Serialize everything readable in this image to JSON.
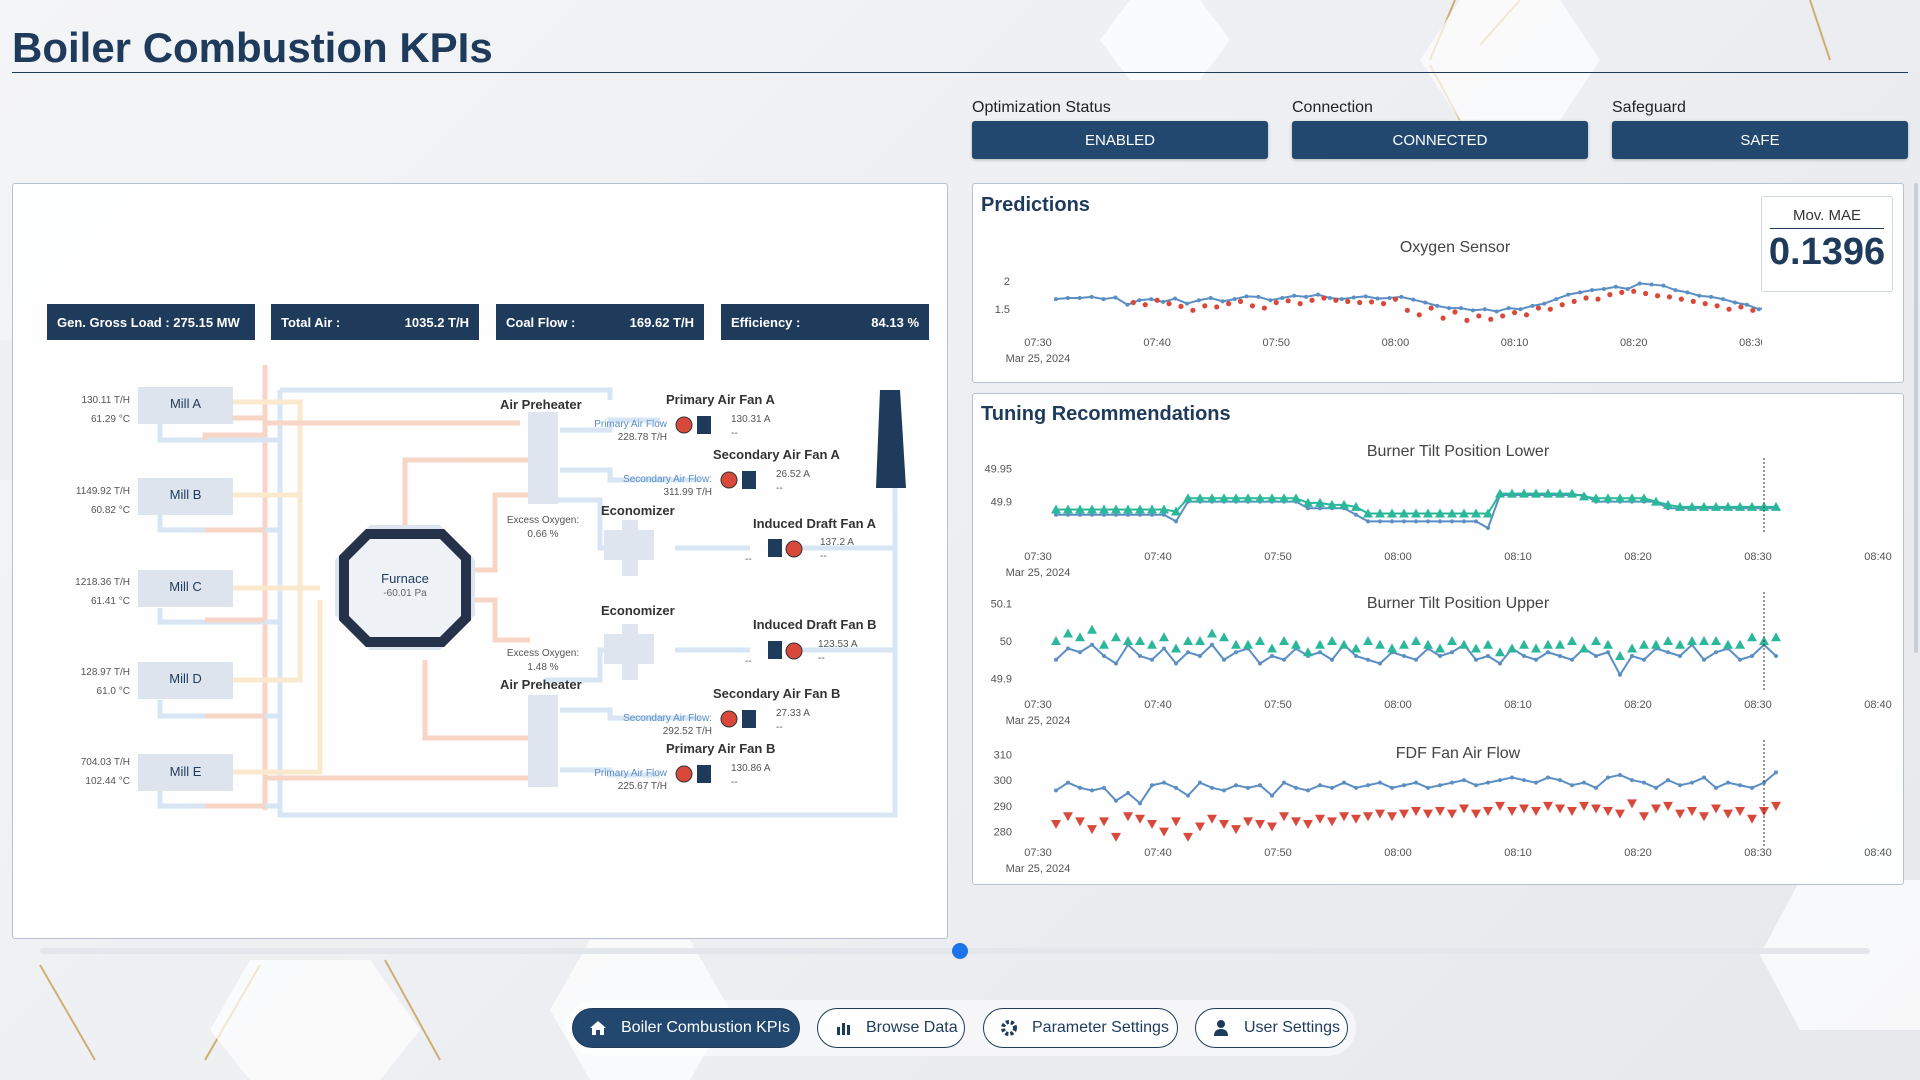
{
  "page": {
    "title": "Boiler Combustion KPIs"
  },
  "status": [
    {
      "label": "Optimization Status",
      "value": "ENABLED"
    },
    {
      "label": "Connection",
      "value": "CONNECTED"
    },
    {
      "label": "Safeguard",
      "value": "SAFE"
    }
  ],
  "kpis": [
    {
      "label": "Gen. Gross Load : 275.15 MW",
      "value": ""
    },
    {
      "label": "Total Air :",
      "value": "1035.2 T/H"
    },
    {
      "label": "Coal Flow :",
      "value": "169.62 T/H"
    },
    {
      "label": "Efficiency :",
      "value": "84.13 %"
    }
  ],
  "mills": [
    {
      "name": "Mill A",
      "flow": "130.11 T/H",
      "temp": "61.29 °C"
    },
    {
      "name": "Mill B",
      "flow": "1149.92 T/H",
      "temp": "60.82 °C"
    },
    {
      "name": "Mill C",
      "flow": "1218.36 T/H",
      "temp": "61.41 °C"
    },
    {
      "name": "Mill D",
      "flow": "128.97 T/H",
      "temp": "61.0 °C"
    },
    {
      "name": "Mill E",
      "flow": "704.03 T/H",
      "temp": "102.44 °C"
    }
  ],
  "furnace": {
    "name": "Furnace",
    "pressure": "-60.01 Pa"
  },
  "diagram": {
    "air_preheater_top": "Air Preheater",
    "air_preheater_bottom": "Air Preheater",
    "economizer_top": "Economizer",
    "economizer_bottom": "Economizer",
    "excess_o2_label": "Excess Oxygen:",
    "excess_o2_top": "0.66 %",
    "excess_o2_bottom": "1.48 %",
    "fans": [
      {
        "name": "Primary Air Fan A",
        "flow_label": "Primary Air Flow",
        "flow": "228.78 T/H",
        "current": "130.31 A",
        "extra": "--"
      },
      {
        "name": "Secondary Air Fan A",
        "flow_label": "Secondary Air Flow:",
        "flow": "311.99 T/H",
        "current": "26.52 A",
        "extra": "--"
      },
      {
        "name": "Induced Draft Fan A",
        "flow_label": "",
        "flow": "--",
        "current": "137.2 A",
        "extra": "--"
      },
      {
        "name": "Induced Draft Fan B",
        "flow_label": "",
        "flow": "--",
        "current": "123.53 A",
        "extra": "--"
      },
      {
        "name": "Secondary Air Fan B",
        "flow_label": "Secondary Air Flow:",
        "flow": "292.52 T/H",
        "current": "27.33 A",
        "extra": "--"
      },
      {
        "name": "Primary Air Fan B",
        "flow_label": "Primary Air Flow",
        "flow": "225.67 T/H",
        "current": "130.86 A",
        "extra": "--"
      }
    ]
  },
  "predictions": {
    "title": "Predictions",
    "mae_label": "Mov. MAE",
    "mae_value": "0.1396",
    "chart_title": "Oxygen Sensor"
  },
  "tuning": {
    "title": "Tuning Recommendations"
  },
  "time_axis": {
    "ticks": [
      "07:30",
      "07:40",
      "07:50",
      "08:00",
      "08:10",
      "08:20",
      "08:30",
      "08:40"
    ],
    "date": "Mar 25, 2024"
  },
  "chart_data": [
    {
      "type": "line",
      "title": "Oxygen Sensor",
      "x_range": [
        "07:30",
        "08:40"
      ],
      "ylim": [
        1.2,
        2.2
      ],
      "yticks": [
        "2",
        "1.5"
      ],
      "series": [
        {
          "name": "",
          "color": "#5b8fc4",
          "x_start_min": 1.5,
          "step_min": 1,
          "values": [
            1.68,
            1.7,
            1.7,
            1.72,
            1.68,
            1.71,
            1.58,
            1.66,
            1.68,
            1.63,
            1.69,
            1.6,
            1.66,
            1.7,
            1.64,
            1.68,
            1.73,
            1.72,
            1.66,
            1.7,
            1.74,
            1.72,
            1.76,
            1.7,
            1.68,
            1.71,
            1.73,
            1.69,
            1.7,
            1.72,
            1.67,
            1.62,
            1.56,
            1.52,
            1.52,
            1.48,
            1.5,
            1.46,
            1.52,
            1.5,
            1.56,
            1.6,
            1.68,
            1.76,
            1.8,
            1.84,
            1.86,
            1.9,
            1.86,
            1.96,
            1.94,
            1.92,
            1.84,
            1.8,
            1.74,
            1.72,
            1.68,
            1.62,
            1.58,
            1.5,
            1.55,
            1.52,
            1.44,
            1.5,
            1.46,
            1.4
          ]
        },
        {
          "name": "",
          "color": "#d9493b",
          "x_start_min": 8,
          "step_min": 1,
          "values": [
            1.62,
            1.58,
            1.66,
            1.6,
            1.55,
            1.48,
            1.56,
            1.54,
            1.6,
            1.64,
            1.56,
            1.52,
            1.62,
            1.65,
            1.6,
            1.66,
            1.7,
            1.66,
            1.64,
            1.62,
            1.63,
            1.6,
            1.68,
            1.48,
            1.4,
            1.52,
            1.34,
            1.45,
            1.3,
            1.38,
            1.32,
            1.38,
            1.44,
            1.4,
            1.52,
            1.5,
            1.58,
            1.64,
            1.7,
            1.68,
            1.76,
            1.8,
            1.82,
            1.78,
            1.74,
            1.72,
            1.68,
            1.64,
            1.6,
            1.56,
            1.5,
            1.54,
            1.48,
            1.5,
            1.44,
            1.48,
            1.4,
            1.38,
            1.36,
            1.38,
            1.36,
            1.34,
            1.3,
            1.32
          ]
        }
      ]
    },
    {
      "type": "line",
      "title": "Burner Tilt Position Lower",
      "x_range": [
        "07:30",
        "08:40"
      ],
      "ylim": [
        49.86,
        49.96
      ],
      "yticks": [
        "49.95",
        "49.9"
      ],
      "series": [
        {
          "name": "",
          "color": "#5b8fc4",
          "marker": "line",
          "x_start_min": 1.5,
          "step_min": 1,
          "values": [
            49.88,
            49.88,
            49.88,
            49.88,
            49.88,
            49.88,
            49.88,
            49.88,
            49.88,
            49.88,
            49.87,
            49.9,
            49.9,
            49.9,
            49.9,
            49.9,
            49.9,
            49.9,
            49.9,
            49.9,
            49.9,
            49.89,
            49.89,
            49.89,
            49.89,
            49.88,
            49.87,
            49.87,
            49.87,
            49.87,
            49.87,
            49.87,
            49.87,
            49.87,
            49.87,
            49.87,
            49.86,
            49.91,
            49.91,
            49.91,
            49.91,
            49.91,
            49.91,
            49.91,
            49.91,
            49.9,
            49.9,
            49.9,
            49.9,
            49.9,
            49.9,
            49.89,
            49.89,
            49.89,
            49.89,
            49.89,
            49.89,
            49.89,
            49.89,
            49.89,
            49.89
          ]
        },
        {
          "name": "",
          "color": "#2bb89a",
          "marker": "triangle-up",
          "x_start_min": 1.5,
          "step_min": 1,
          "values": [
            49.888,
            49.888,
            49.888,
            49.888,
            49.888,
            49.888,
            49.888,
            49.888,
            49.888,
            49.888,
            49.885,
            49.905,
            49.905,
            49.905,
            49.905,
            49.905,
            49.905,
            49.905,
            49.905,
            49.905,
            49.905,
            49.898,
            49.898,
            49.895,
            49.895,
            49.892,
            49.882,
            49.882,
            49.882,
            49.882,
            49.882,
            49.882,
            49.882,
            49.882,
            49.882,
            49.882,
            49.882,
            49.912,
            49.912,
            49.912,
            49.912,
            49.912,
            49.912,
            49.912,
            49.908,
            49.905,
            49.905,
            49.905,
            49.905,
            49.905,
            49.9,
            49.895,
            49.892,
            49.892,
            49.892,
            49.892,
            49.892,
            49.892,
            49.892,
            49.892,
            49.892
          ]
        }
      ]
    },
    {
      "type": "scatter",
      "title": "Burner Tilt Position Upper",
      "x_range": [
        "07:30",
        "08:40"
      ],
      "ylim": [
        49.88,
        50.12
      ],
      "yticks": [
        "50.1",
        "50",
        "49.9"
      ],
      "series": [
        {
          "name": "",
          "color": "#5b8fc4",
          "marker": "line",
          "x_start_min": 1.5,
          "step_min": 1,
          "values": [
            49.95,
            49.98,
            49.97,
            49.99,
            49.96,
            49.94,
            49.99,
            49.96,
            49.95,
            49.98,
            49.94,
            49.97,
            49.96,
            49.99,
            49.95,
            49.97,
            49.98,
            49.94,
            49.96,
            49.95,
            49.98,
            49.96,
            49.97,
            49.95,
            49.99,
            49.96,
            49.95,
            49.94,
            49.97,
            49.96,
            49.95,
            49.98,
            49.96,
            49.97,
            49.99,
            49.95,
            49.96,
            49.94,
            49.98,
            49.96,
            49.95,
            49.97,
            49.96,
            49.95,
            49.98,
            49.96,
            49.97,
            49.91,
            49.96,
            49.95,
            49.98,
            49.97,
            49.96,
            49.99,
            49.95,
            49.97,
            49.98,
            49.95,
            49.96,
            49.99,
            49.96
          ]
        },
        {
          "name": "",
          "color": "#2bb89a",
          "marker": "triangle-up",
          "x_start_min": 1.5,
          "step_min": 1,
          "values": [
            50.0,
            50.02,
            50.01,
            50.03,
            49.99,
            50.01,
            50.0,
            50.0,
            49.99,
            50.01,
            49.98,
            50.0,
            50.0,
            50.02,
            50.01,
            49.99,
            49.99,
            50.0,
            49.98,
            50.0,
            49.99,
            49.97,
            49.99,
            50.0,
            49.99,
            49.98,
            50.0,
            49.99,
            49.98,
            49.99,
            50.0,
            49.99,
            49.98,
            50.0,
            49.99,
            49.98,
            49.99,
            49.97,
            49.98,
            49.99,
            49.98,
            49.99,
            49.99,
            50.0,
            49.98,
            50.0,
            49.99,
            49.96,
            49.98,
            49.99,
            49.99,
            50.0,
            49.99,
            50.0,
            50.0,
            50.0,
            49.99,
            49.99,
            50.01,
            50.0,
            50.01
          ]
        }
      ]
    },
    {
      "type": "line",
      "title": "FDF Fan Air Flow",
      "x_range": [
        "07:30",
        "08:40"
      ],
      "ylim": [
        276,
        314
      ],
      "yticks": [
        "310",
        "300",
        "290",
        "280"
      ],
      "series": [
        {
          "name": "",
          "color": "#5b8fc4",
          "marker": "line",
          "x_start_min": 1.5,
          "step_min": 1,
          "values": [
            296,
            299,
            297,
            296,
            297,
            292,
            295,
            291,
            298,
            299,
            297,
            294,
            299,
            297,
            296,
            298,
            297,
            298,
            294,
            299,
            297,
            296,
            298,
            297,
            299,
            297,
            298,
            299,
            297,
            298,
            299,
            297,
            298,
            299,
            300,
            298,
            299,
            300,
            301,
            300,
            299,
            301,
            300,
            298,
            299,
            297,
            301,
            302,
            300,
            299,
            297,
            300,
            298,
            299,
            301,
            297,
            299,
            298,
            297,
            299,
            303
          ]
        },
        {
          "name": "",
          "color": "#d9493b",
          "marker": "triangle-down",
          "x_start_min": 1.5,
          "step_min": 1,
          "values": [
            283,
            286,
            284,
            281,
            284,
            278,
            286,
            285,
            283,
            280,
            284,
            278,
            282,
            285,
            283,
            281,
            284,
            283,
            282,
            286,
            284,
            283,
            285,
            284,
            286,
            285,
            286,
            287,
            286,
            287,
            288,
            287,
            288,
            287,
            289,
            287,
            288,
            290,
            288,
            289,
            288,
            290,
            289,
            288,
            290,
            289,
            288,
            287,
            291,
            286,
            289,
            290,
            287,
            288,
            286,
            289,
            287,
            288,
            285,
            288,
            290
          ]
        }
      ]
    }
  ],
  "nav": [
    {
      "label": "Boiler Combustion KPIs",
      "icon": "home-icon",
      "active": true
    },
    {
      "label": "Browse Data",
      "icon": "bar-chart-icon",
      "active": false
    },
    {
      "label": "Parameter Settings",
      "icon": "gear-icon",
      "active": false
    },
    {
      "label": "User Settings",
      "icon": "user-icon",
      "active": false
    }
  ]
}
